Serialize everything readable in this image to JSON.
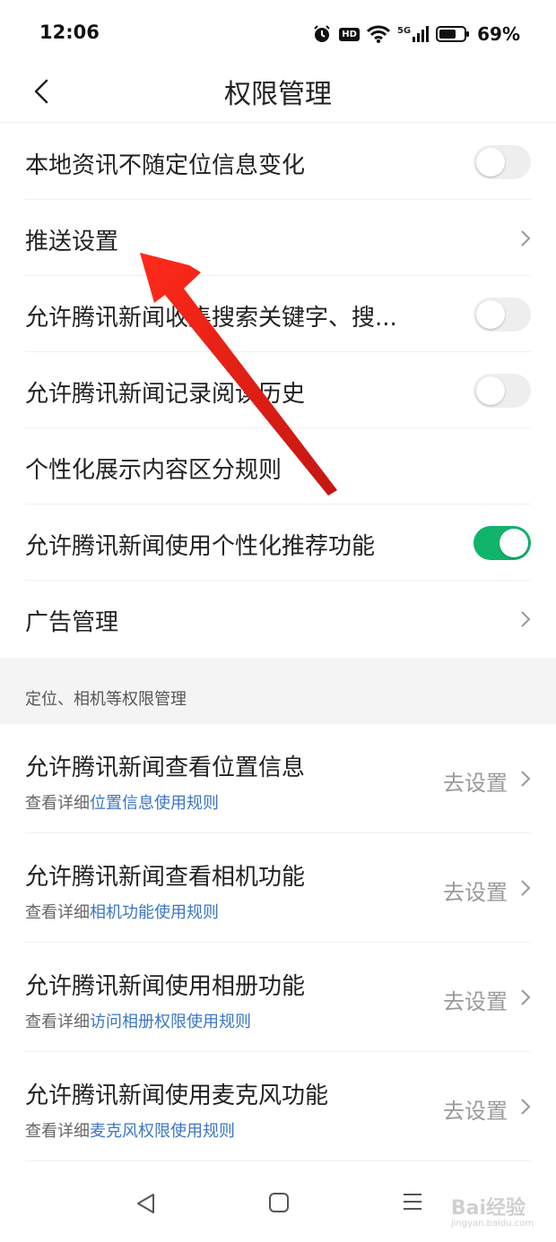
{
  "status_bar": {
    "time": "12:06",
    "hd_badge": "HD",
    "network": "5G",
    "battery_percent": "69%",
    "battery_level": 0.69,
    "icons": [
      "alarm-icon",
      "hd-icon",
      "wifi-icon",
      "signal-5g-icon",
      "battery-icon"
    ]
  },
  "header": {
    "title": "权限管理",
    "back_icon": "back-arrow-icon"
  },
  "settings": [
    {
      "label": "本地资讯不随定位信息变化",
      "control": "toggle",
      "on": false
    },
    {
      "label": "推送设置",
      "control": "chevron"
    },
    {
      "label": "允许腾讯新闻收集搜索关键字、搜...",
      "control": "toggle",
      "on": false
    },
    {
      "label": "允许腾讯新闻记录阅读历史",
      "control": "toggle",
      "on": false
    },
    {
      "label": "个性化展示内容区分规则",
      "control": "none"
    },
    {
      "label": "允许腾讯新闻使用个性化推荐功能",
      "control": "toggle",
      "on": true
    },
    {
      "label": "广告管理",
      "control": "chevron"
    }
  ],
  "section_header": "定位、相机等权限管理",
  "permissions": [
    {
      "title": "允许腾讯新闻查看位置信息",
      "sub_prefix": "查看详细",
      "sub_link": "位置信息使用规则",
      "action": "去设置"
    },
    {
      "title": "允许腾讯新闻查看相机功能",
      "sub_prefix": "查看详细",
      "sub_link": "相机功能使用规则",
      "action": "去设置"
    },
    {
      "title": "允许腾讯新闻使用相册功能",
      "sub_prefix": "查看详细",
      "sub_link": "访问相册权限使用规则",
      "action": "去设置"
    },
    {
      "title": "允许腾讯新闻使用麦克风功能",
      "sub_prefix": "查看详细",
      "sub_link": "麦克风权限使用规则",
      "action": "去设置"
    }
  ],
  "system_nav": {
    "icons": [
      "nav-back-triangle-icon",
      "nav-home-square-icon",
      "nav-menu-icon"
    ]
  },
  "watermark": {
    "text": "Bai经验",
    "url": "jingyan.baidu.com"
  },
  "colors": {
    "toggle_on": "#10b36a",
    "toggle_off": "#eeeeee",
    "link": "#3a76c6",
    "annotation_arrow": "#e8201f",
    "section_bg": "#f4f4f4"
  }
}
